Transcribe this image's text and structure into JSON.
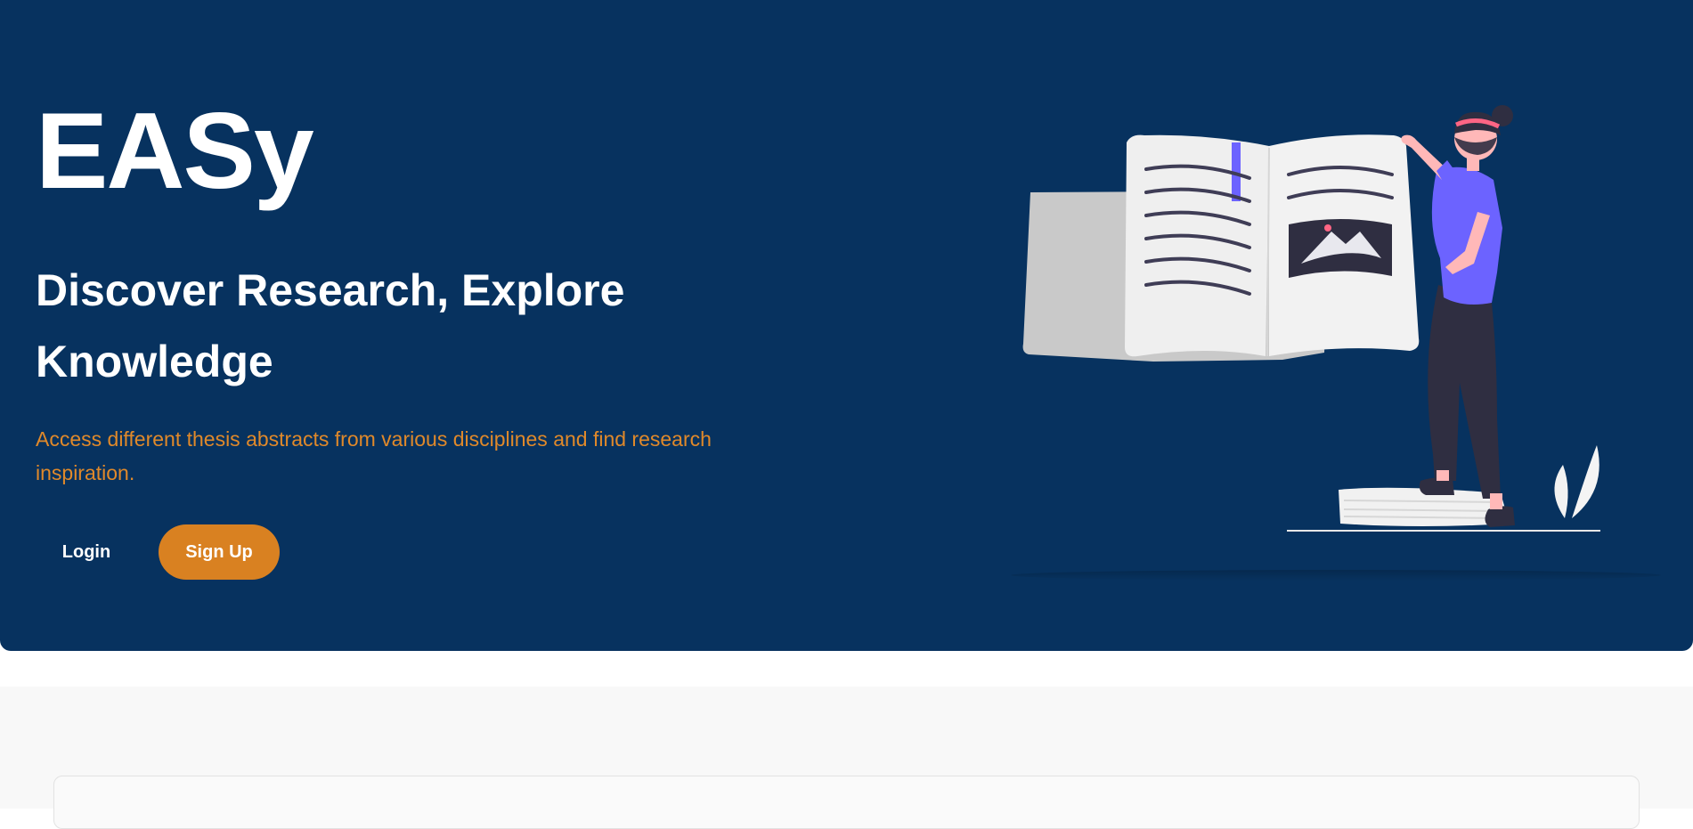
{
  "hero": {
    "brand": "EASy",
    "headline": "Discover Research, Explore Knowledge",
    "tagline": "Access different thesis abstracts from various disciplines and find research inspiration.",
    "background_color": "#07325f",
    "tagline_color": "#e0892a"
  },
  "actions": {
    "login_label": "Login",
    "signup_label": "Sign Up",
    "signup_color": "#d98121"
  },
  "illustration": {
    "icon": "woman-reading-book-illustration"
  }
}
